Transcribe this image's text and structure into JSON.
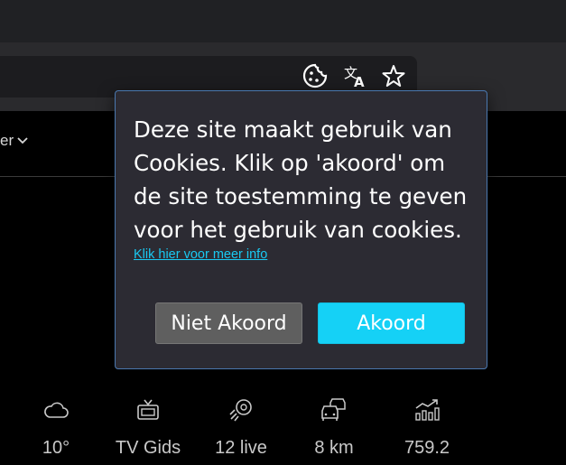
{
  "browser": {
    "icons": [
      "cookie-icon",
      "translate-icon",
      "star-icon"
    ]
  },
  "nav": {
    "partial_item_label": "er"
  },
  "cookie_popup": {
    "message": "Deze site maakt gebruik van Cookies. Klik op 'akoord' om de site toestemming te geven voor het gebruik van cookies.",
    "info_link": "Klik hier voor meer info",
    "decline_label": "Niet Akoord",
    "accept_label": "Akoord",
    "accent_color": "#15d1f6",
    "border_color": "#4a78b0"
  },
  "info_bar": [
    {
      "icon": "cloud-icon",
      "label": "10°"
    },
    {
      "icon": "tv-icon",
      "label": "TV Gids"
    },
    {
      "icon": "ball-icon",
      "label": "12 live"
    },
    {
      "icon": "traffic-icon",
      "label": "8 km"
    },
    {
      "icon": "stocks-icon",
      "label": "759.2"
    }
  ]
}
